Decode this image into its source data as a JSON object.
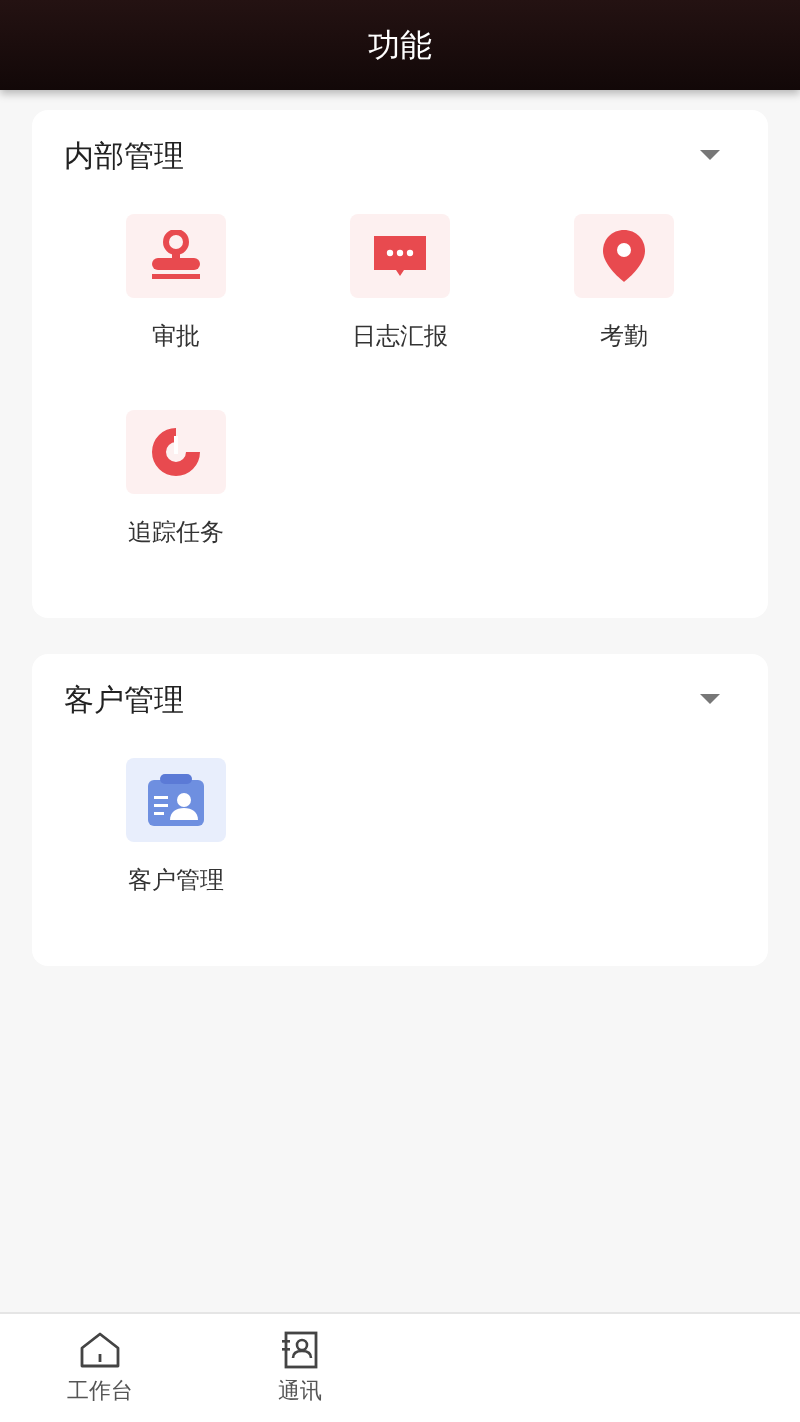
{
  "header": {
    "title": "功能"
  },
  "sections": [
    {
      "title": "内部管理",
      "items": [
        {
          "label": "审批",
          "kind": "stamp"
        },
        {
          "label": "日志汇报",
          "kind": "message"
        },
        {
          "label": "考勤",
          "kind": "location"
        },
        {
          "label": "追踪任务",
          "kind": "track"
        }
      ]
    },
    {
      "title": "客户管理",
      "items": [
        {
          "label": "客户管理",
          "kind": "contact"
        }
      ]
    }
  ],
  "tab_bar": [
    {
      "label": "工作台",
      "kind": "home"
    },
    {
      "label": "通讯",
      "kind": "contacts"
    }
  ]
}
